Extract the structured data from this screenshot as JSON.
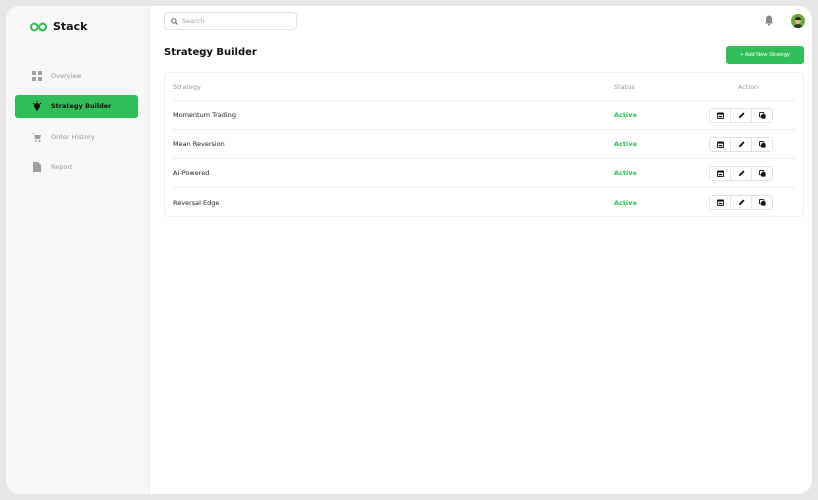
{
  "brand": {
    "name": "Stack",
    "accent": "#31bd57"
  },
  "sidebar": {
    "items": [
      {
        "label": "Overview",
        "icon": "grid-icon"
      },
      {
        "label": "Strategy Builder",
        "icon": "bulb-icon",
        "active": true
      },
      {
        "label": "Order History",
        "icon": "cart-icon"
      },
      {
        "label": "Report",
        "icon": "report-icon"
      }
    ]
  },
  "header": {
    "search_placeholder": "Search"
  },
  "page": {
    "title": "Strategy Builder",
    "add_button": "+ Add New Strategy"
  },
  "table": {
    "columns": [
      "Strategy",
      "Status",
      "Action"
    ],
    "rows": [
      {
        "name": "Momentum Trading",
        "status": "Active"
      },
      {
        "name": "Mean Reversion",
        "status": "Active"
      },
      {
        "name": "AI-Powered",
        "status": "Active"
      },
      {
        "name": "Reversal Edge",
        "status": "Active"
      }
    ]
  }
}
